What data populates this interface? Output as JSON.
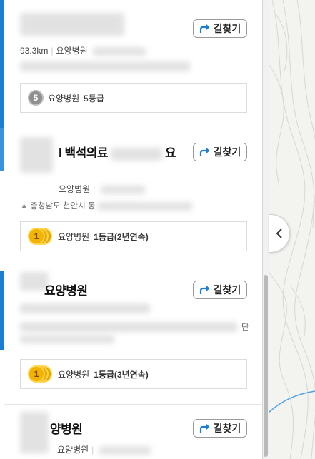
{
  "directions_label": "길찾기",
  "cards": [
    {
      "name": "",
      "distance": "93.3km",
      "category": "요양병원",
      "address": "",
      "grade_type": "요양병원",
      "grade_value": "5등급",
      "medal_number": "5"
    },
    {
      "name": "백석의료",
      "name_suffix": "요",
      "category": "요양병원",
      "address": "충청남도 천안시 동",
      "grade_type": "요양병원",
      "grade_value": "1등급(2년연속)",
      "medal_number": "1"
    },
    {
      "name": "요양병원",
      "grade_type": "요양병원",
      "grade_value": "1등급(3년연속)",
      "medal_number": "1",
      "address_suffix": "단"
    },
    {
      "name": "양병원",
      "category": "요양병원"
    }
  ],
  "colors": {
    "accent": "#1a7fd4",
    "map_road": "#4aa3e8"
  }
}
